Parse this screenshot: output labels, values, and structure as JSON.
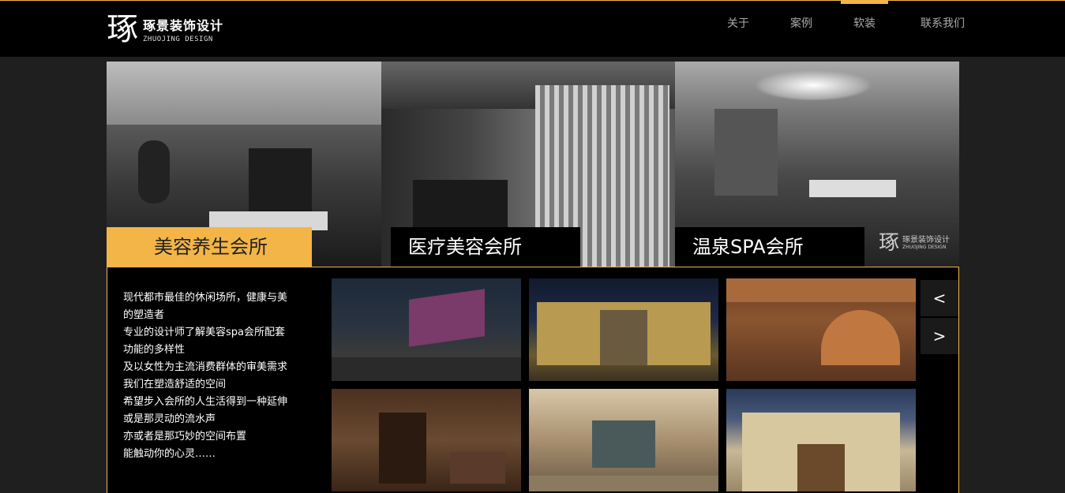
{
  "brand": {
    "mark": "琢",
    "name_cn": "琢景装饰设计",
    "name_en": "ZHUOJING DESIGN"
  },
  "nav": {
    "items": [
      {
        "label": "关于",
        "active": false
      },
      {
        "label": "案例",
        "active": false
      },
      {
        "label": "软装",
        "active": true
      },
      {
        "label": "联系我们",
        "active": false
      }
    ]
  },
  "banner": {
    "captions": [
      "美容养生会所",
      "医疗美容会所",
      "温泉SPA会所"
    ],
    "active_index": 0,
    "watermark": {
      "mark": "琢",
      "name": "琢景装饰设计",
      "sub": "ZHUOJING DESIGN"
    }
  },
  "description": {
    "lines": [
      "现代都市最佳的休闲场所，健康与美",
      "的塑造者",
      "专业的设计师了解美容spa会所配套",
      "功能的多样性",
      "及以女性为主流消费群体的审美需求",
      "我们在塑造舒适的空间",
      "希望步入会所的人生活得到一种延伸",
      "或是那灵动的流水声",
      "亦或者是那巧妙的空间布置",
      "能触动你的心灵……"
    ]
  },
  "gallery": {
    "prev_label": "<",
    "next_label": ">"
  },
  "colors": {
    "accent": "#f3b548",
    "header_bg": "#000000",
    "page_bg": "#1f1f1f"
  }
}
